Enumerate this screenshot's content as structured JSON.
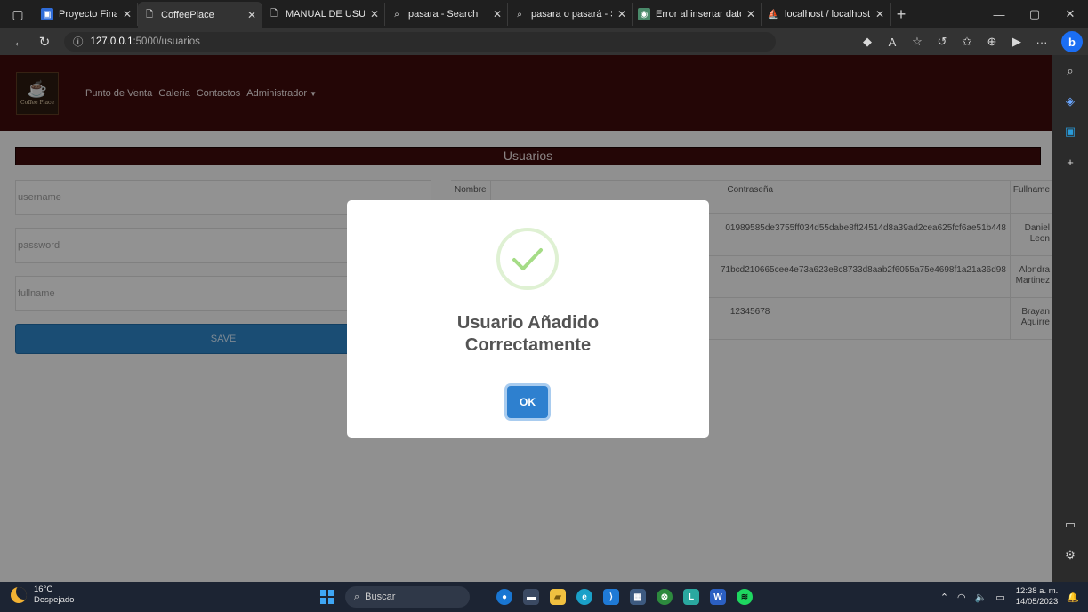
{
  "browser": {
    "tabs": [
      {
        "title": "Proyecto Final de la m",
        "fav_color": "#2f6cd8",
        "fav_glyph": "▣",
        "active": false
      },
      {
        "title": "CoffeePlace",
        "fav_color": "transparent",
        "fav_glyph": "🗋",
        "active": true
      },
      {
        "title": "MANUAL DE USUARIO",
        "fav_color": "transparent",
        "fav_glyph": "🗋",
        "active": false
      },
      {
        "title": "pasara - Search",
        "fav_color": "transparent",
        "fav_glyph": "⌕",
        "active": false
      },
      {
        "title": "pasara o pasará - Sear",
        "fav_color": "transparent",
        "fav_glyph": "⌕",
        "active": false
      },
      {
        "title": "Error al insertar datos.",
        "fav_color": "#4a8a6a",
        "fav_glyph": "◉",
        "active": false
      },
      {
        "title": "localhost / localhost /",
        "fav_color": "transparent",
        "fav_glyph": "⛵",
        "active": false
      }
    ],
    "url_host": "127.0.0.1",
    "url_path": ":5000/usuarios"
  },
  "site": {
    "logo_text": "Coffee Place",
    "nav": [
      "Punto de Venta",
      "Galeria",
      "Contactos",
      "Administrador"
    ]
  },
  "section_title": "Usuarios",
  "form": {
    "username_placeholder": "username",
    "password_placeholder": "password",
    "fullname_placeholder": "fullname",
    "save_label": "SAVE"
  },
  "table": {
    "headers": [
      "Nombre",
      "Contraseña",
      "Fullname"
    ],
    "rows": [
      {
        "password": "01989585de3755ff034d55dabe8ff24514d8a39ad2cea625fcf6ae51b448",
        "fullname": [
          "Daniel",
          "Leon"
        ]
      },
      {
        "password": "71bcd210665cee4e73a623e8c8733d8aab2f6055a75e4698f1a21a36d98",
        "fullname": [
          "Alondra",
          "Martinez"
        ]
      },
      {
        "password": "12345678",
        "fullname": [
          "Brayan",
          "Aguirre"
        ]
      }
    ]
  },
  "modal": {
    "title_line1": "Usuario Añadido",
    "title_line2": "Correctamente",
    "ok_label": "OK",
    "success_color": "#a5dc86"
  },
  "taskbar": {
    "temp": "16°C",
    "weather": "Despejado",
    "search_label": "Buscar",
    "time": "12:38 a. m.",
    "date": "14/05/2023"
  }
}
